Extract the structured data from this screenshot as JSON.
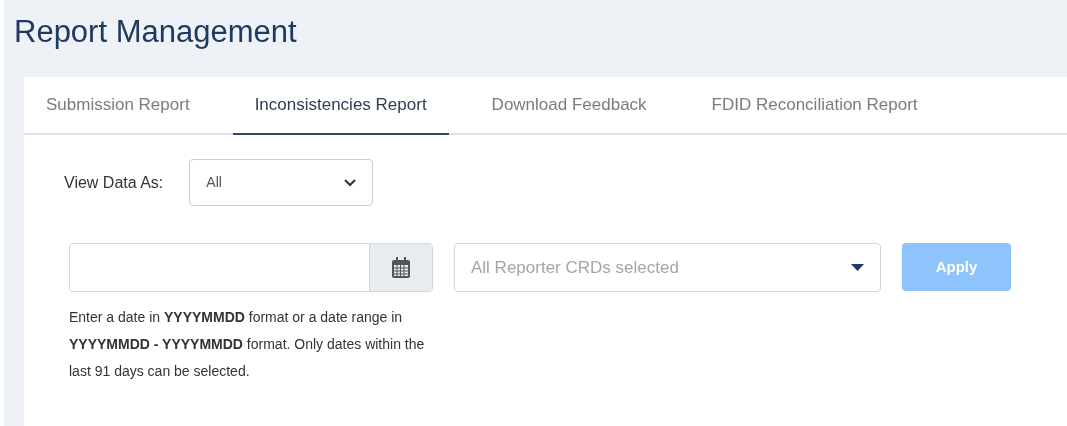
{
  "page_title": "Report Management",
  "tabs": [
    {
      "label": "Submission Report",
      "selected": false
    },
    {
      "label": "Inconsistencies Report",
      "selected": true
    },
    {
      "label": "Download Feedback",
      "selected": false
    },
    {
      "label": "FDID Reconciliation Report",
      "selected": false
    }
  ],
  "view_data_as": {
    "label": "View Data As:",
    "value": "All"
  },
  "date_field": {
    "help": "Enter a date in **YYYYMMDD** format or a date range in **YYYYMMDD - YYYYMMDD** format. Only dates within the last 91 days can be selected."
  },
  "reporter_select": {
    "placeholder": "All Reporter CRDs selected"
  },
  "apply_button": {
    "label": "Apply",
    "disabled": true
  }
}
